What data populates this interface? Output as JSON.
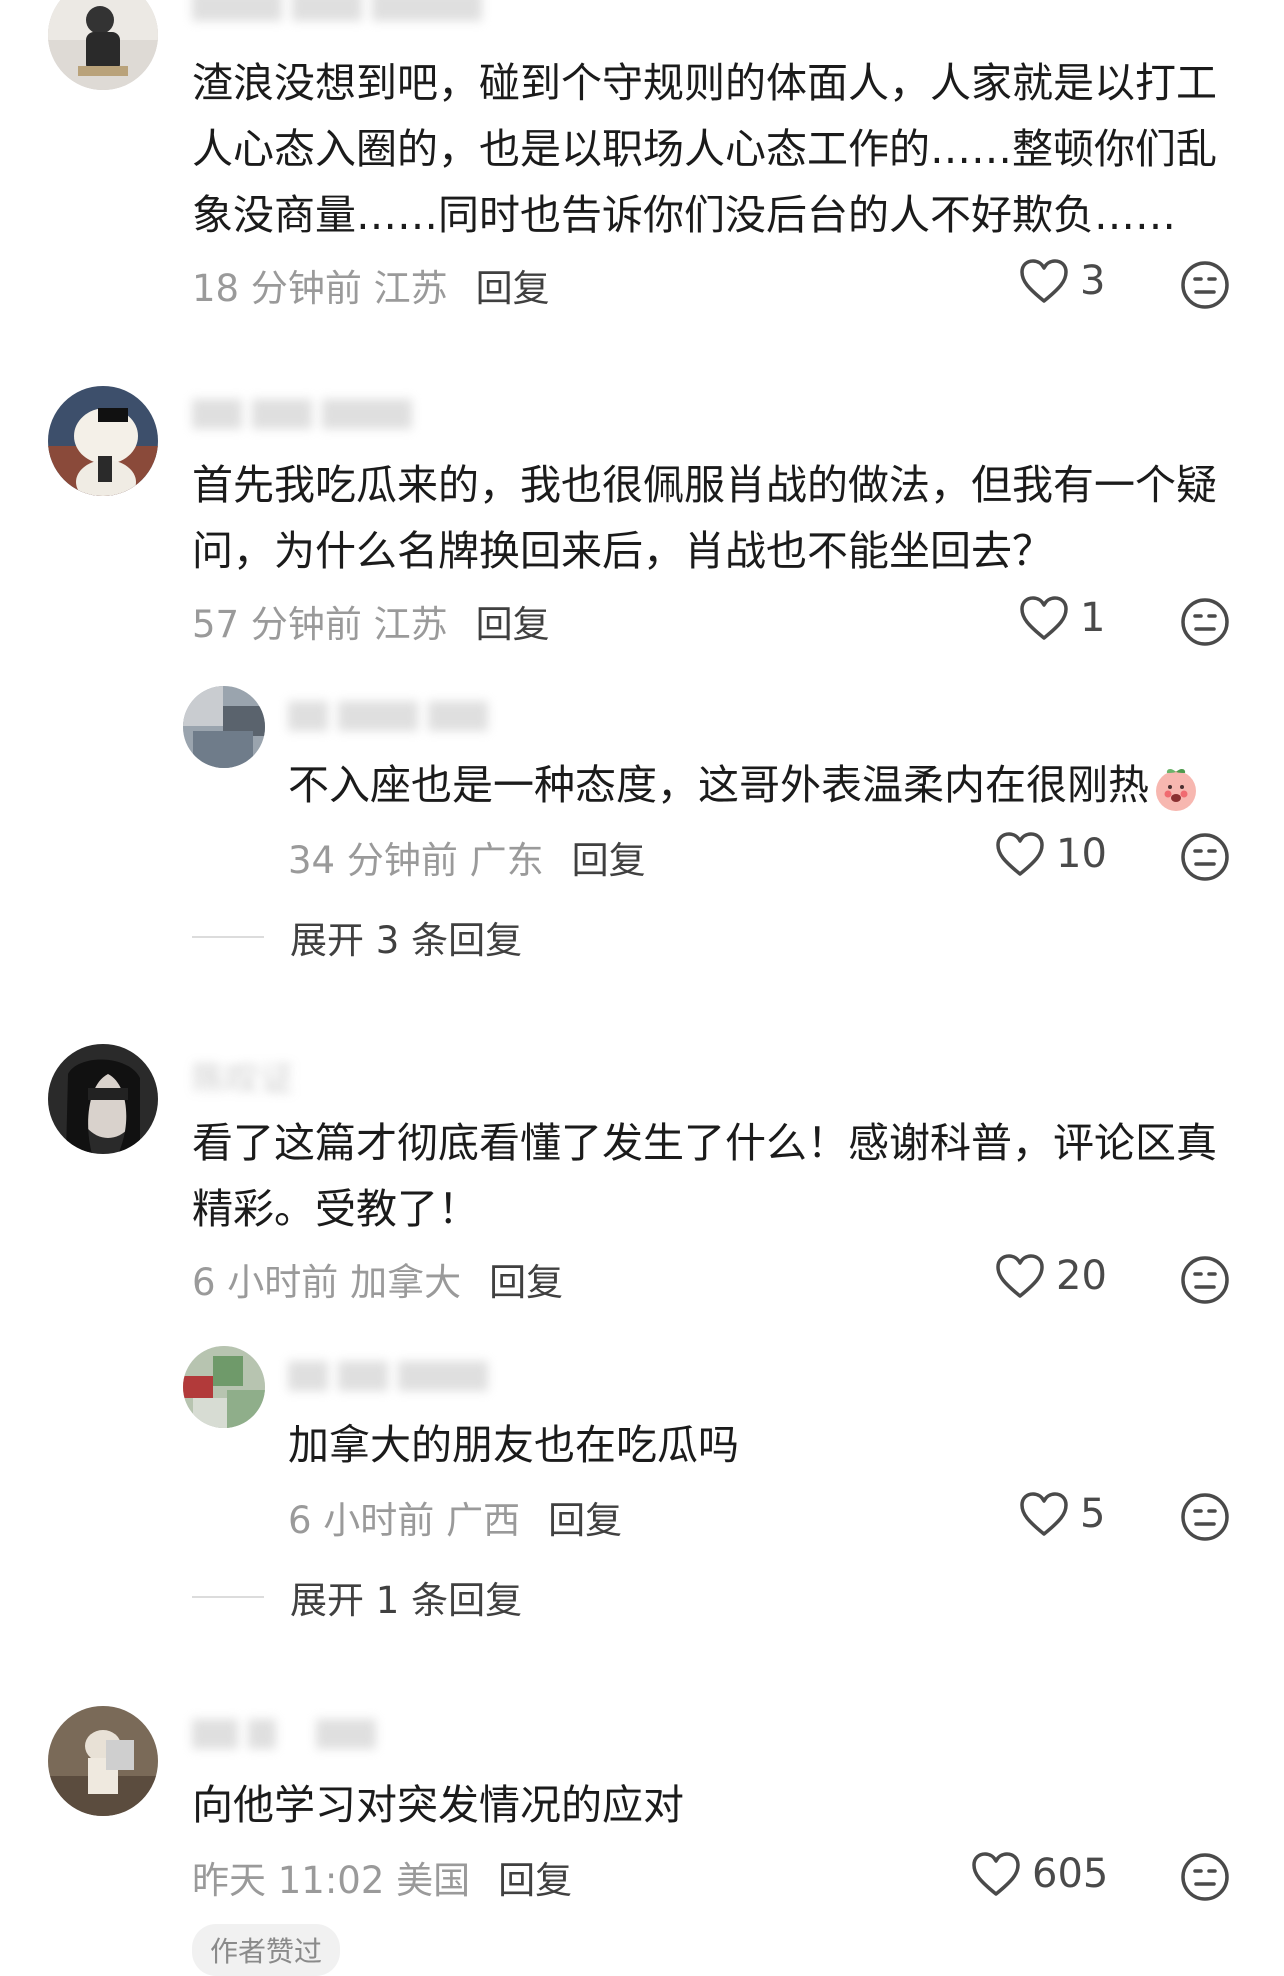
{
  "comments": [
    {
      "username": "渣浪……",
      "text": "渣浪没想到吧，碰到个守规则的体面人，人家就是以打工人心态入圈的，也是以职场人心态工作的……整顿你们乱象没商量……同时也告诉你们没后台的人不好欺负……",
      "time_location": "18 分钟前 江苏",
      "reply_label": "回复",
      "likes": "3"
    },
    {
      "text": "首先我吃瓜来的，我也很佩服肖战的做法，但我有一个疑问，为什么名牌换回来后，肖战也不能坐回去？",
      "time_location": "57 分钟前 江苏",
      "reply_label": "回复",
      "likes": "1",
      "sub_reply": {
        "text": "不入座也是一种态度，这哥外表温柔内在很刚热",
        "time_location": "34 分钟前 广东",
        "reply_label": "回复",
        "likes": "10"
      },
      "expand_label": "展开 3 条回复"
    },
    {
      "username": "陈叹证",
      "text": "看了这篇才彻底看懂了发生了什么！感谢科普，评论区真精彩。受教了！",
      "time_location": "6 小时前 加拿大",
      "reply_label": "回复",
      "likes": "20",
      "sub_reply": {
        "text": "加拿大的朋友也在吃瓜吗",
        "time_location": "6 小时前 广西",
        "reply_label": "回复",
        "likes": "5"
      },
      "expand_label": "展开 1 条回复"
    },
    {
      "text": "向他学习对突发情况的应对",
      "time_location": "昨天 11:02 美国",
      "reply_label": "回复",
      "likes": "605",
      "badge": "作者赞过"
    }
  ],
  "icons": {
    "like": "heart-outline-icon",
    "dislike": "neutral-face-icon",
    "emoji": "blushing-peach-emoji"
  },
  "colors": {
    "text": "#1b1b1b",
    "meta": "#9a9a9a",
    "reply": "#404040",
    "badge_bg": "#f1f1f1"
  }
}
